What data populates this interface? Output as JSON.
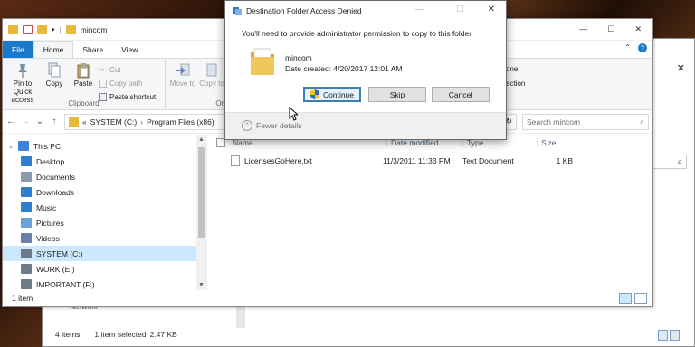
{
  "back_window": {
    "search_glyph": "⌕",
    "close_glyph": "✕",
    "network_label": "Network",
    "status": {
      "items": "4 items",
      "selected": "1 item selected",
      "size": "2.47 KB"
    }
  },
  "explorer": {
    "window_title": "mincom",
    "win_controls": {
      "minimize": "—",
      "maximize": "☐",
      "close": "✕"
    },
    "tabs": {
      "file": "File",
      "home": "Home",
      "share": "Share",
      "view": "View"
    },
    "ribbon_right": {
      "collapse": "⌃",
      "help": "?"
    },
    "ribbon": {
      "clipboard": {
        "pin_label": "Pin to Quick access",
        "copy_label": "Copy",
        "paste_label": "Paste",
        "cut_label": "Cut",
        "copy_path_label": "Copy path",
        "paste_shortcut_label": "Paste shortcut",
        "group_label": "Clipboard"
      },
      "organize": {
        "move_to_label": "Move to",
        "copy_to_label": "Copy to",
        "group_label_partial": "Org"
      },
      "right_partial": {
        "new_label": "one",
        "select_label": "ection"
      }
    },
    "address": {
      "back": "←",
      "forward": "→",
      "recent": "⌄",
      "up": "↑",
      "path_prefix": "«",
      "crumb1": "SYSTEM (C:)",
      "crumb2": "Program Files (x86)",
      "crumb_sep": "›",
      "dropdown": "⌄",
      "refresh": "↻",
      "search_placeholder": "Search mincom",
      "search_glyph": "⌕"
    },
    "nav_items": [
      {
        "label": "This PC",
        "color": "#3d83d6"
      },
      {
        "label": "Desktop",
        "color": "#2f7fd1"
      },
      {
        "label": "Documents",
        "color": "#8a9bb0"
      },
      {
        "label": "Downloads",
        "color": "#2f7fd1"
      },
      {
        "label": "Music",
        "color": "#2f7fd1"
      },
      {
        "label": "Pictures",
        "color": "#6aa2d8"
      },
      {
        "label": "Videos",
        "color": "#6a7fa6"
      },
      {
        "label": "SYSTEM (C:)",
        "color": "#6c7a89"
      },
      {
        "label": "WORK (E:)",
        "color": "#6c7a89"
      },
      {
        "label": "IMPORTANT (F:)",
        "color": "#6c7a89"
      }
    ],
    "columns": {
      "name": "Name",
      "date": "Date modified",
      "type": "Type",
      "size": "Size",
      "sort_glyph": "^"
    },
    "files": [
      {
        "name": "LicensesGoHere.txt",
        "date": "11/3/2011 11:33 PM",
        "type": "Text Document",
        "size": "1 KB"
      }
    ],
    "status": {
      "count": "1 item"
    }
  },
  "dialog": {
    "title": "Destination Folder Access Denied",
    "controls": {
      "minimize": "—",
      "maximize": "☐",
      "close": "✕"
    },
    "message": "You'll need to provide administrator permission to copy to this folder",
    "folder_name": "mincom",
    "date_created": "Date created: 4/20/2017 12:01 AM",
    "continue_label": "Continue",
    "skip_label": "Skip",
    "cancel_label": "Cancel",
    "fewer_details_label": "Fewer details",
    "fewer_glyph": "⌃"
  },
  "colors": {
    "accent": "#1979ca",
    "selection": "#cce8ff",
    "folder": "#e8b93d"
  }
}
